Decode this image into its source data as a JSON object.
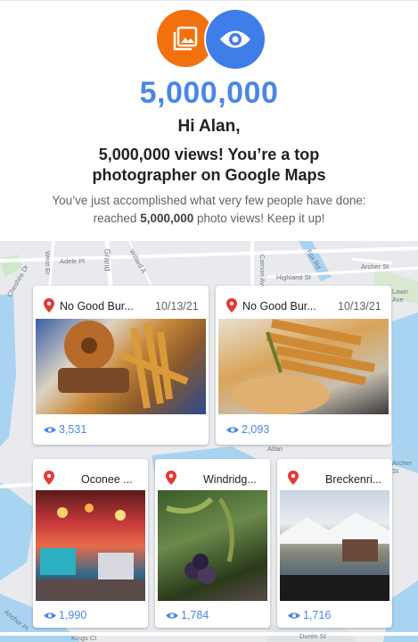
{
  "header": {
    "icons": [
      "photo-library-icon",
      "eye-icon"
    ],
    "colors": {
      "photo_icon_bg": "#f2700e",
      "eye_icon_bg": "#3f7de8",
      "accent": "#4a86e8"
    },
    "big_number": "5,000,000",
    "greeting": "Hi Alan,",
    "message": "5,000,000 views! You’re a top photographer on Google Maps",
    "sub_pre": "You’ve just accomplished what very few people have done: reached ",
    "sub_bold": "5,000,000",
    "sub_post": " photo views! Keep it up!"
  },
  "map": {
    "labels": [
      "Adele Pl",
      "Grand",
      "Willard A",
      "West Er",
      "Cheshire Dr",
      "Carnon Ave",
      "Highland St",
      "Fox Rd",
      "Archer St",
      "Lawn Ave",
      "Archer St",
      "Anchor Pl",
      "Atlan",
      "Duren St",
      "Kings Ct"
    ]
  },
  "photos": [
    {
      "place": "No Good Bur...",
      "date": "10/13/21",
      "views": "3,531"
    },
    {
      "place": "No Good Bur...",
      "date": "10/13/21",
      "views": "2,093"
    },
    {
      "place": "Oconee ...",
      "views": "1,990"
    },
    {
      "place": "Windridg...",
      "views": "1,784"
    },
    {
      "place": "Breckenri...",
      "views": "1,716"
    }
  ]
}
